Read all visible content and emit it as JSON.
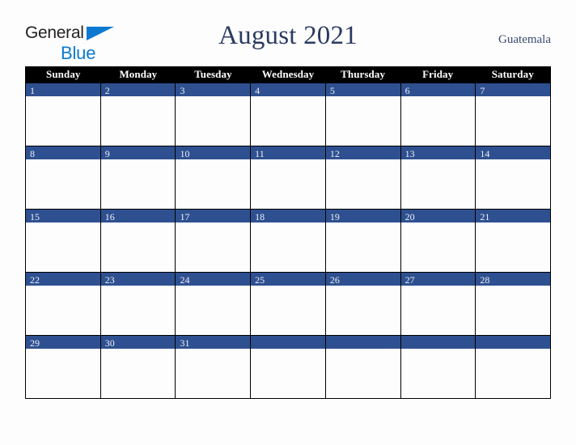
{
  "brand": {
    "name_part1": "General",
    "name_part2": "Blue",
    "triangle_icon": "brand-triangle-icon",
    "accent_color": "#0b79d0",
    "text_color": "#231f20"
  },
  "header": {
    "title": "August 2021",
    "month": "August",
    "year": "2021",
    "country": "Guatemala",
    "title_color": "#2b3a63"
  },
  "calendar": {
    "header_background": "#000000",
    "header_text_color": "#ffffff",
    "day_band_color": "#2e5090",
    "day_number_color": "#eef1f7",
    "cell_background": "#fdfdfd",
    "border_color": "#000000",
    "weekdays": [
      "Sunday",
      "Monday",
      "Tuesday",
      "Wednesday",
      "Thursday",
      "Friday",
      "Saturday"
    ],
    "weeks": [
      [
        {
          "number": "1"
        },
        {
          "number": "2"
        },
        {
          "number": "3"
        },
        {
          "number": "4"
        },
        {
          "number": "5"
        },
        {
          "number": "6"
        },
        {
          "number": "7"
        }
      ],
      [
        {
          "number": "8"
        },
        {
          "number": "9"
        },
        {
          "number": "10"
        },
        {
          "number": "11"
        },
        {
          "number": "12"
        },
        {
          "number": "13"
        },
        {
          "number": "14"
        }
      ],
      [
        {
          "number": "15"
        },
        {
          "number": "16"
        },
        {
          "number": "17"
        },
        {
          "number": "18"
        },
        {
          "number": "19"
        },
        {
          "number": "20"
        },
        {
          "number": "21"
        }
      ],
      [
        {
          "number": "22"
        },
        {
          "number": "23"
        },
        {
          "number": "24"
        },
        {
          "number": "25"
        },
        {
          "number": "26"
        },
        {
          "number": "27"
        },
        {
          "number": "28"
        }
      ],
      [
        {
          "number": "29"
        },
        {
          "number": "30"
        },
        {
          "number": "31"
        },
        {
          "number": ""
        },
        {
          "number": ""
        },
        {
          "number": ""
        },
        {
          "number": ""
        }
      ]
    ]
  }
}
